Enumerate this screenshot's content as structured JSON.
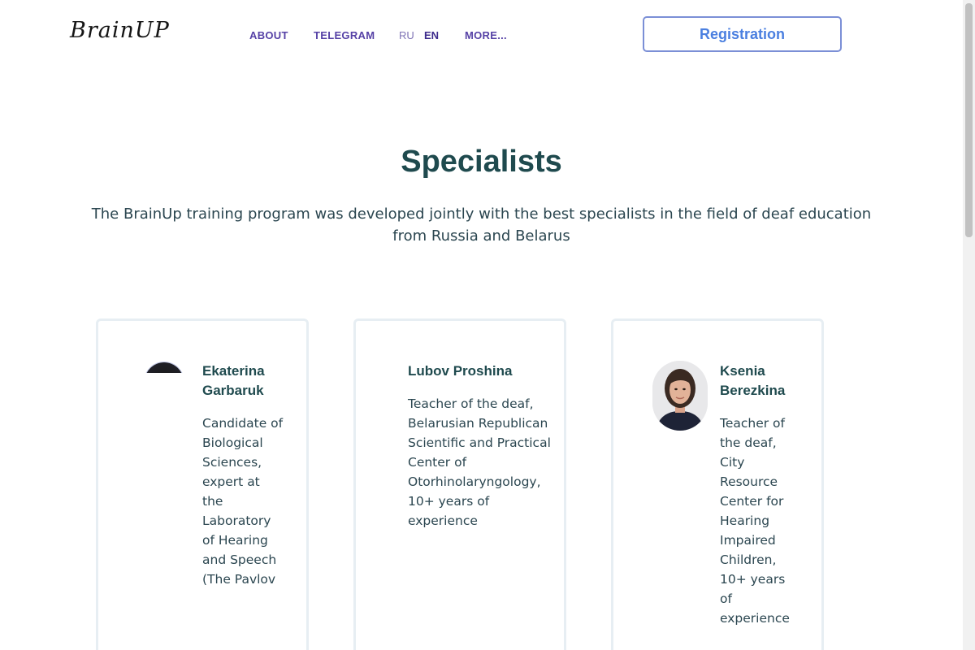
{
  "header": {
    "logo_text": "BrainUP",
    "nav": {
      "about": "ABOUT",
      "telegram": "TELEGRAM",
      "lang_ru": "RU",
      "lang_en": "EN",
      "more": "MORE..."
    },
    "registration_label": "Registration"
  },
  "section": {
    "title": "Specialists",
    "subtitle": "The BrainUp training program was developed jointly with the best specialists in the field of deaf education from Russia and Belarus"
  },
  "specialists": [
    {
      "name": "Ekaterina Garbaruk",
      "description": "Candidate of Biological Sciences, expert at the Laboratory of Hearing and Speech (The Pavlov"
    },
    {
      "name": "Lubov Proshina",
      "description": "Teacher of the deaf, Belarusian Republican Scientific and Practical Center of Otorhinolaryngology, 10+ years of experience"
    },
    {
      "name": "Ksenia Berezkina",
      "description": "Teacher of the deaf, City Resource Center for Hearing Impaired Children, 10+ years of experience"
    }
  ],
  "colors": {
    "nav": "#5641a6",
    "heading": "#1f4a4e",
    "body_text": "#2b4650",
    "button_border": "#7b8fd6",
    "button_text": "#4a7fe0",
    "card_border": "#e7eef3"
  }
}
